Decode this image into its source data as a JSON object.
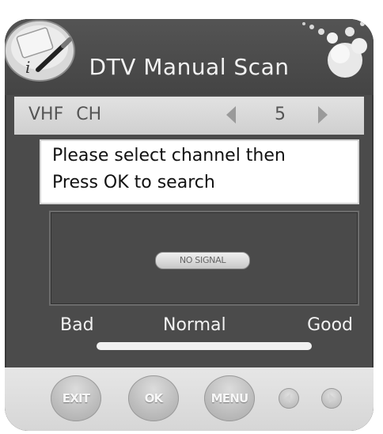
{
  "screen": {
    "title": "DTV Manual Scan"
  },
  "channel": {
    "band": "VHF",
    "ch_label": "CH",
    "value": "5"
  },
  "instructions": {
    "line1": "Please select channel then",
    "line2": "Press OK to search"
  },
  "signal": {
    "status": "NO SIGNAL",
    "quality_labels": {
      "bad": "Bad",
      "normal": "Normal",
      "good": "Good"
    }
  },
  "footer": {
    "exit_label": "EXIT",
    "ok_label": "OK",
    "menu_label": "MENU"
  },
  "icons": {
    "app_badge": "info-pencil-icon",
    "decoration": "bubbles-icon",
    "left": "chevron-left-icon",
    "right": "chevron-right-icon"
  },
  "colors": {
    "panel_bg": "#4b4b4b",
    "channel_bar": "#d9d9d9",
    "button": "#c2c2c2"
  }
}
